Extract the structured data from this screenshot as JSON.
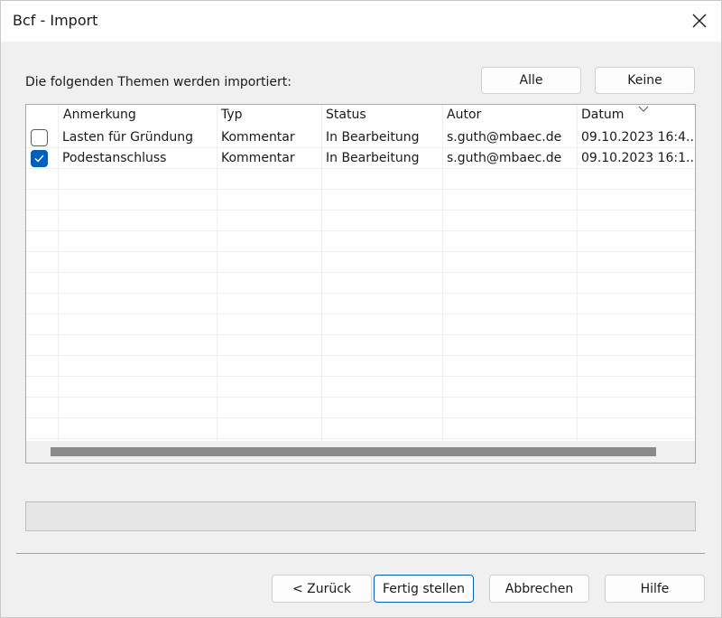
{
  "window": {
    "title": "Bcf - Import"
  },
  "prompt": "Die folgenden Themen werden importiert:",
  "top_buttons": {
    "all": "Alle",
    "none": "Keine"
  },
  "columns": [
    "Anmerkung",
    "Typ",
    "Status",
    "Autor",
    "Datum"
  ],
  "rows": [
    {
      "checked": false,
      "anmerkung": "Lasten für Gründung",
      "typ": "Kommentar",
      "status": "In Bearbeitung",
      "autor": "s.guth@mbaec.de",
      "datum": "09.10.2023 16:4..."
    },
    {
      "checked": true,
      "anmerkung": "Podestanschluss",
      "typ": "Kommentar",
      "status": "In Bearbeitung",
      "autor": "s.guth@mbaec.de",
      "datum": "09.10.2023 16:1..."
    }
  ],
  "footer_buttons": {
    "back": "< Zurück",
    "finish": "Fertig stellen",
    "cancel": "Abbrechen",
    "help": "Hilfe"
  },
  "colors": {
    "accent": "#005fb8",
    "background": "#f0f0f0"
  },
  "icons": {
    "close": "close-icon",
    "sort": "chevron-down-icon",
    "check": "checkmark-icon"
  }
}
